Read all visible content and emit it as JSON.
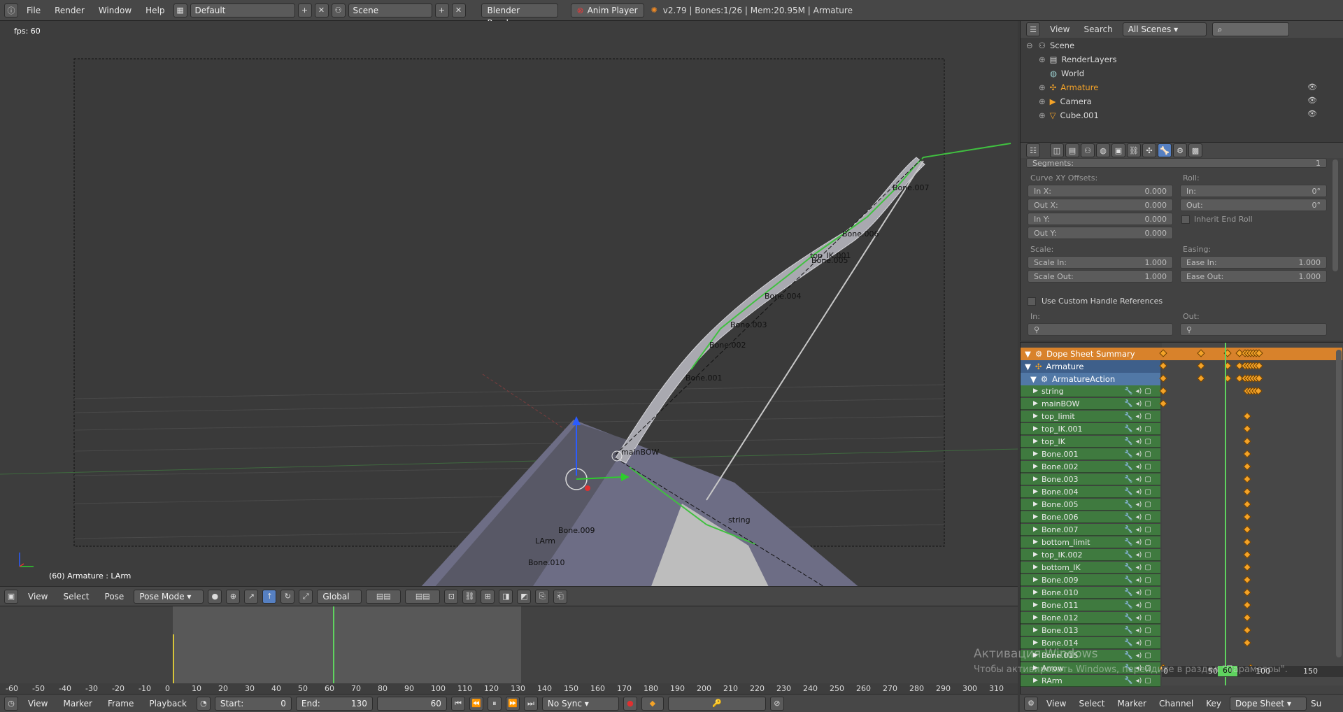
{
  "top_bar": {
    "menus": [
      "File",
      "Render",
      "Window",
      "Help"
    ],
    "layout": "Default",
    "scene": "Scene",
    "engine": "Blender Render",
    "anim_player": "Anim Player",
    "status": "v2.79 | Bones:1/26 | Mem:20.95M | Armature"
  },
  "viewport": {
    "fps": "fps: 60",
    "status": "(60) Armature : LArm",
    "bone_labels": [
      "Bone.007",
      "Bone.006",
      "Bone.005",
      "top_IK.001",
      "Bone.004",
      "Bone.003",
      "Bone.002",
      "Bone.001",
      "mainBOW",
      "string",
      "Bone.009",
      "LArm",
      "Bone.010"
    ],
    "header": {
      "menus": [
        "View",
        "Select",
        "Pose"
      ],
      "mode": "Pose Mode",
      "orientation": "Global"
    }
  },
  "outliner": {
    "menus": [
      "View",
      "Search"
    ],
    "filter": "All Scenes",
    "items": [
      {
        "label": "Scene"
      },
      {
        "label": "RenderLayers"
      },
      {
        "label": "World"
      },
      {
        "label": "Armature"
      },
      {
        "label": "Camera"
      },
      {
        "label": "Cube.001"
      }
    ]
  },
  "properties": {
    "segments_label": "Segments:",
    "segments_value": "1",
    "curve_xy_label": "Curve XY Offsets:",
    "roll_label": "Roll:",
    "in_x": {
      "label": "In X:",
      "value": "0.000"
    },
    "out_x": {
      "label": "Out X:",
      "value": "0.000"
    },
    "in_y": {
      "label": "In Y:",
      "value": "0.000"
    },
    "out_y": {
      "label": "Out Y:",
      "value": "0.000"
    },
    "roll_in": {
      "label": "In:",
      "value": "0°"
    },
    "roll_out": {
      "label": "Out:",
      "value": "0°"
    },
    "inherit_end_roll": "Inherit End Roll",
    "scale_label": "Scale:",
    "easing_label": "Easing:",
    "scale_in": {
      "label": "Scale In:",
      "value": "1.000"
    },
    "scale_out": {
      "label": "Scale Out:",
      "value": "1.000"
    },
    "ease_in": {
      "label": "Ease In:",
      "value": "1.000"
    },
    "ease_out": {
      "label": "Ease Out:",
      "value": "1.000"
    },
    "custom_handle": "Use Custom Handle References",
    "in_label": "In:",
    "out_label": "Out:"
  },
  "dopesheet": {
    "summary": "Dope Sheet Summary",
    "object": "Armature",
    "action": "ArmatureAction",
    "channels": [
      "string",
      "mainBOW",
      "top_limit",
      "top_IK.001",
      "top_IK",
      "Bone.001",
      "Bone.002",
      "Bone.003",
      "Bone.004",
      "Bone.005",
      "Bone.006",
      "Bone.007",
      "bottom_limit",
      "top_IK.002",
      "bottom_IK",
      "Bone.009",
      "Bone.010",
      "Bone.011",
      "Bone.012",
      "Bone.013",
      "Bone.014",
      "Bone.015",
      "Arrow",
      "RArm"
    ],
    "ruler": [
      "0",
      "50",
      "100",
      "150"
    ],
    "current_frame": "60",
    "header": {
      "menus": [
        "View",
        "Select",
        "Marker",
        "Channel",
        "Key"
      ],
      "mode": "Dope Sheet",
      "trailing": "Su"
    }
  },
  "timeline": {
    "ruler": [
      "-60",
      "-50",
      "-40",
      "-30",
      "-20",
      "-10",
      "0",
      "10",
      "20",
      "30",
      "40",
      "50",
      "60",
      "70",
      "80",
      "90",
      "100",
      "110",
      "120",
      "130",
      "140",
      "150",
      "160",
      "170",
      "180",
      "190",
      "200",
      "210",
      "220",
      "230",
      "240",
      "250",
      "260",
      "270",
      "280",
      "290",
      "300",
      "310"
    ],
    "header": {
      "menus": [
        "View",
        "Marker",
        "Frame",
        "Playback"
      ],
      "start": {
        "label": "Start:",
        "value": "0"
      },
      "end": {
        "label": "End:",
        "value": "130"
      },
      "current": "60",
      "sync": "No Sync"
    }
  },
  "watermark": {
    "line1": "Активация Windows",
    "line2": "Чтобы активировать Windows, перейдите в раздел \"Параметры\"."
  },
  "colors": {
    "accent_orange": "#f4a328",
    "summary_bg": "#d8822b",
    "channel_green": "#3f7a3f",
    "frame_line": "#5fd35f"
  }
}
